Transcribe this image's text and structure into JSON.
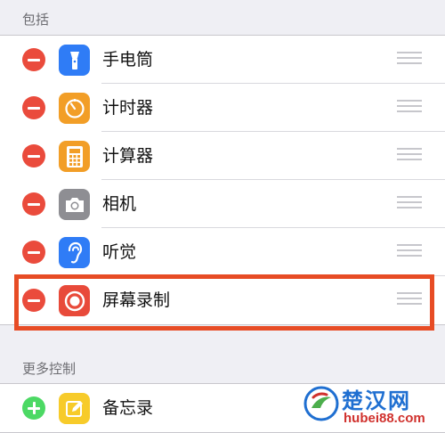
{
  "sections": {
    "include_header": "包括",
    "more_header": "更多控制"
  },
  "included_controls": [
    {
      "label": "手电筒",
      "icon": "flashlight-icon",
      "color": "#2f7cf6"
    },
    {
      "label": "计时器",
      "icon": "timer-icon",
      "color": "#f29e27"
    },
    {
      "label": "计算器",
      "icon": "calculator-icon",
      "color": "#f29e27"
    },
    {
      "label": "相机",
      "icon": "camera-icon",
      "color": "#8e8e93"
    },
    {
      "label": "听觉",
      "icon": "hearing-icon",
      "color": "#2f7cf6"
    },
    {
      "label": "屏幕录制",
      "icon": "screen-recording-icon",
      "color": "#e84a3a",
      "highlighted": true
    }
  ],
  "more_controls": [
    {
      "label": "备忘录",
      "icon": "notes-icon",
      "color": "#f7cb2a"
    }
  ],
  "watermark": {
    "title": "楚汉网",
    "url": "hubei88.com"
  },
  "colors": {
    "remove": "#ea4b3c",
    "add": "#4cd964",
    "highlight": "#e74c25"
  }
}
